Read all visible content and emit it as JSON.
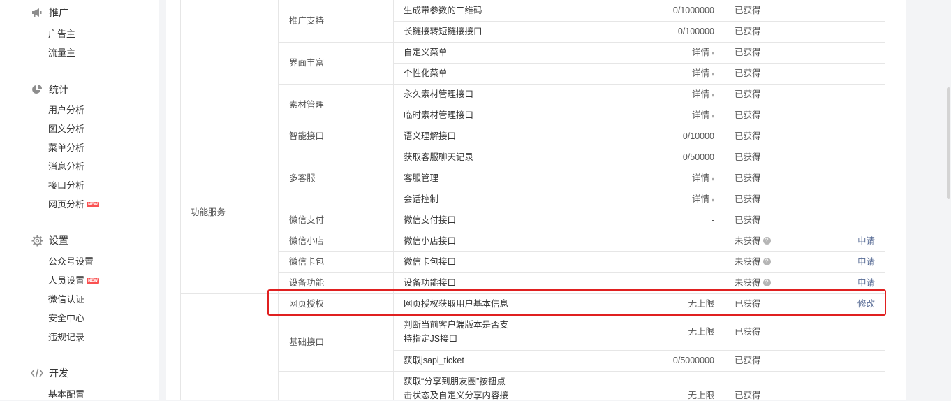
{
  "sidebar": {
    "sections": [
      {
        "title": "推广",
        "icon": "megaphone-icon",
        "items": [
          {
            "label": "广告主"
          },
          {
            "label": "流量主"
          }
        ]
      },
      {
        "title": "统计",
        "icon": "pie-chart-icon",
        "items": [
          {
            "label": "用户分析"
          },
          {
            "label": "图文分析"
          },
          {
            "label": "菜单分析"
          },
          {
            "label": "消息分析"
          },
          {
            "label": "接口分析"
          },
          {
            "label": "网页分析",
            "badge": "NEW"
          }
        ]
      },
      {
        "title": "设置",
        "icon": "gear-icon",
        "items": [
          {
            "label": "公众号设置"
          },
          {
            "label": "人员设置",
            "badge": "NEW"
          },
          {
            "label": "微信认证"
          },
          {
            "label": "安全中心"
          },
          {
            "label": "违规记录"
          }
        ]
      },
      {
        "title": "开发",
        "icon": "code-icon",
        "items": [
          {
            "label": "基本配置"
          }
        ]
      }
    ]
  },
  "table": {
    "groups": [
      {
        "label": "功能服务"
      }
    ],
    "categories": [
      {
        "label": "推广支持"
      },
      {
        "label": "界面丰富"
      },
      {
        "label": "素材管理"
      },
      {
        "label": "智能接口"
      },
      {
        "label": "多客服"
      },
      {
        "label": "微信支付"
      },
      {
        "label": "微信小店"
      },
      {
        "label": "微信卡包"
      },
      {
        "label": "设备功能"
      },
      {
        "label": "网页授权"
      },
      {
        "label": "基础接口"
      }
    ],
    "rows": [
      {
        "name": "生成带参数的二维码",
        "quota": "0/1000000",
        "status": "已获得",
        "action": ""
      },
      {
        "name": "长链接转短链接接口",
        "quota": "0/100000",
        "status": "已获得",
        "action": ""
      },
      {
        "name": "自定义菜单",
        "quota": "详情",
        "status": "已获得",
        "action": ""
      },
      {
        "name": "个性化菜单",
        "quota": "详情",
        "status": "已获得",
        "action": ""
      },
      {
        "name": "永久素材管理接口",
        "quota": "详情",
        "status": "已获得",
        "action": ""
      },
      {
        "name": "临时素材管理接口",
        "quota": "详情",
        "status": "已获得",
        "action": ""
      },
      {
        "name": "语义理解接口",
        "quota": "0/10000",
        "status": "已获得",
        "action": ""
      },
      {
        "name": "获取客服聊天记录",
        "quota": "0/50000",
        "status": "已获得",
        "action": ""
      },
      {
        "name": "客服管理",
        "quota": "详情",
        "status": "已获得",
        "action": ""
      },
      {
        "name": "会话控制",
        "quota": "详情",
        "status": "已获得",
        "action": ""
      },
      {
        "name": "微信支付接口",
        "quota": "-",
        "status": "已获得",
        "action": ""
      },
      {
        "name": "微信小店接口",
        "quota": "",
        "status": "未获得",
        "action": "申请"
      },
      {
        "name": "微信卡包接口",
        "quota": "",
        "status": "未获得",
        "action": "申请"
      },
      {
        "name": "设备功能接口",
        "quota": "",
        "status": "未获得",
        "action": "申请"
      },
      {
        "name": "网页授权获取用户基本信息",
        "quota": "无上限",
        "status": "已获得",
        "action": "修改"
      },
      {
        "name_line1": "判断当前客户端版本是否支",
        "name_line2": "持指定JS接口",
        "quota": "无上限",
        "status": "已获得",
        "action": ""
      },
      {
        "name": "获取jsapi_ticket",
        "quota": "0/5000000",
        "status": "已获得",
        "action": ""
      },
      {
        "name_line1": "获取“分享到朋友圈”按钮点",
        "name_line2": "击状态及自定义分享内容接",
        "quota": "无上限",
        "status": "已获得",
        "action": ""
      }
    ],
    "help_glyph": "?",
    "caret_glyph": "▾"
  },
  "colors": {
    "highlight": "#e02020",
    "link": "#576b95",
    "badge": "#fa5151"
  }
}
